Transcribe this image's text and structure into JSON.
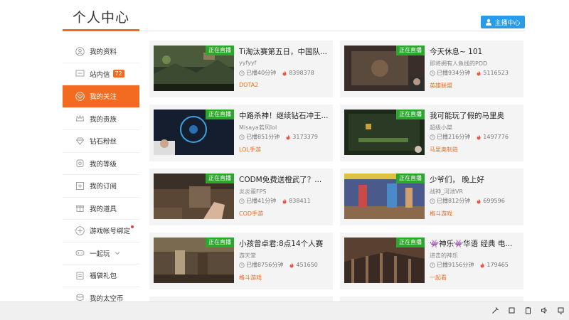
{
  "header": {
    "title": "个人中心",
    "anchor_button": "主播中心"
  },
  "sidebar": {
    "items": [
      {
        "label": "我的资料",
        "icon": "user-icon"
      },
      {
        "label": "站内信",
        "icon": "message-icon",
        "badge": "72"
      },
      {
        "label": "我的关注",
        "icon": "heart-icon",
        "active": true
      },
      {
        "label": "我的贵族",
        "icon": "crown-icon"
      },
      {
        "label": "钻石粉丝",
        "icon": "diamond-icon"
      },
      {
        "label": "我的等级",
        "icon": "level-icon"
      },
      {
        "label": "我的订阅",
        "icon": "subscribe-icon"
      },
      {
        "label": "我的道具",
        "icon": "gift-icon"
      },
      {
        "label": "游戏帐号绑定",
        "icon": "game-bind-icon",
        "dot": true
      },
      {
        "label": "一起玩",
        "icon": "gamepad-icon",
        "chevron": true
      },
      {
        "label": "福袋礼包",
        "icon": "lucky-bag-icon"
      },
      {
        "label": "我的太空币",
        "icon": "coin-icon"
      }
    ]
  },
  "live_tag": "正在直播",
  "cards": [
    {
      "title": "Ti淘汰赛第五日，中国队...",
      "streamer": "yyfyyf",
      "duration": "已播40分钟",
      "heat": "8398378",
      "category": "DOTA2"
    },
    {
      "title": "今天休息~ 101",
      "streamer": "即将拥有人鱼线的PDD",
      "duration": "已播934分钟",
      "heat": "5116523",
      "category": "英雄联盟"
    },
    {
      "title": "中路杀神！继续钻石冲王...",
      "streamer": "Misaya若风lol",
      "duration": "已播851分钟",
      "heat": "3173379",
      "category": "LOL手游"
    },
    {
      "title": "我可能玩了假的马里奥",
      "streamer": "超级小桀",
      "duration": "已播216分钟",
      "heat": "1497776",
      "category": "马里奥制造"
    },
    {
      "title": "CODM免费送橙武了？...",
      "streamer": "炎炎蛋FPS",
      "duration": "已播41分钟",
      "heat": "838411",
      "category": "COD手游"
    },
    {
      "title": "少爷们，  晚上好",
      "streamer": "战神_河池VR",
      "duration": "已播812分钟",
      "heat": "699596",
      "category": "格斗游戏"
    },
    {
      "title": "小孩曾卓君:8点14个人赛",
      "streamer": "游天堂",
      "duration": "已播8756分钟",
      "heat": "451650",
      "category": "格斗游戏"
    },
    {
      "title": "👾神乐👾华语 经典 电...",
      "streamer": "进击的神乐",
      "duration": "已播9156分钟",
      "heat": "179465",
      "category": "一起看"
    }
  ],
  "colors": {
    "accent": "#f26b21",
    "live": "#2da62d",
    "anchor": "#2a9be6"
  }
}
